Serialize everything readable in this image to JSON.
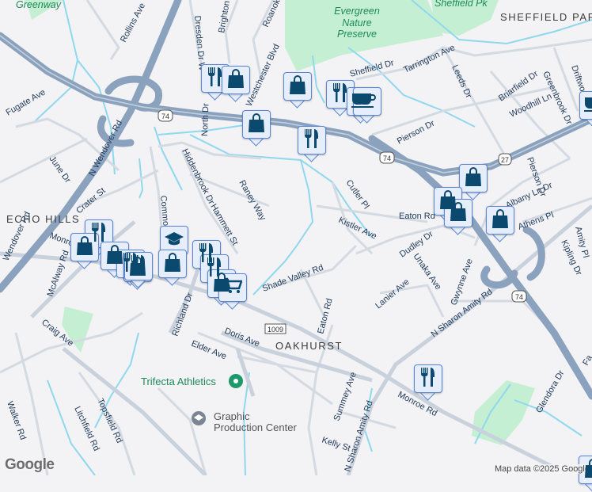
{
  "map": {
    "neighborhoods": [
      "ECHO HILLS",
      "OAKHURST",
      "SHEFFIELD PARK"
    ],
    "parks": [
      "Greenway",
      "Evergreen",
      "Nature",
      "Preserve",
      "Sheffield Pk"
    ],
    "pois": {
      "trifecta": "Trifecta Athletics",
      "graphic_1": "Graphic",
      "graphic_2": "Production Center"
    },
    "shields": {
      "us74": "74",
      "us27": "27",
      "sr1009": "1009"
    },
    "streets": {
      "rollins": "Rollins Ave",
      "dresden": "Dresden Dr W",
      "brighton": "Brighton",
      "roanoke": "Roanoke",
      "westchester": "Westchester Blvd",
      "north": "North Dr",
      "fugate": "Fugate Ave",
      "wendover_n": "N Wendover Rd",
      "wendover": "Wendover Rd",
      "june": "June Dr",
      "crater": "Crater St",
      "hiddenbrook": "Hiddenbrook Dr",
      "raney": "Raney Way",
      "hammett": "Hammett St",
      "commonwealth": "Commo",
      "monroe_w": "Monroe",
      "sheffield": "Sheffield Dr",
      "tarrington": "Tarrington Ave",
      "leeds": "Leeds Dr",
      "briarfield": "Briarfield Dr",
      "greenbrook": "Greenbrook Dr",
      "woodhill": "Woodhill Ln",
      "driftwood": "Driftwood",
      "pierson": "Pierson Dr",
      "pierson2": "Pierson Dr",
      "cutler": "Cutler Pl",
      "eaton": "Eaton Rd",
      "kistler": "Kistler Ave",
      "albany": "Albany Ln Dr",
      "athens": "Athens Pl",
      "dudley": "Dudley Dr",
      "unaka": "Unaka Ave",
      "gwynne": "Gwynne Ave",
      "kipling": "Kipling Dr",
      "amity": "Amity Pl",
      "shade": "Shade Valley Rd",
      "lanier": "Lanier Ave",
      "eaton2": "Eaton Rd",
      "sharon": "N Sharon Amity Rd",
      "sharon2": "N Sharon Amity Rd",
      "mcalway": "McAlway Rd",
      "craig": "Craig Ave",
      "richland": "Richland Dr",
      "doris": "Doris Ave",
      "elder": "Elder Ave",
      "summey": "Summey Ave",
      "monroe": "Monroe Rd",
      "kelly": "Kelly St",
      "walker": "Walker Rd",
      "topsfield": "Topsfield Rd",
      "litchfield": "Litchfield Rd",
      "glendora": "Glendora Dr",
      "fa": "Fa"
    },
    "attribution": "Map data ©2025 Google",
    "logo": "Google"
  },
  "markers": [
    {
      "type": "restaurant"
    },
    {
      "type": "shopping"
    },
    {
      "type": "shopping"
    },
    {
      "type": "restaurant"
    },
    {
      "type": "cafe"
    },
    {
      "type": "cafe"
    },
    {
      "type": "shopping"
    },
    {
      "type": "restaurant"
    },
    {
      "type": "shopping"
    },
    {
      "type": "shopping"
    },
    {
      "type": "shopping"
    },
    {
      "type": "shopping"
    },
    {
      "type": "cafe"
    },
    {
      "type": "school"
    },
    {
      "type": "restaurant"
    },
    {
      "type": "shopping"
    },
    {
      "type": "shopping"
    },
    {
      "type": "restaurant"
    },
    {
      "type": "shopping"
    },
    {
      "type": "restaurant"
    },
    {
      "type": "shopping"
    },
    {
      "type": "restaurant"
    },
    {
      "type": "restaurant"
    },
    {
      "type": "shopping"
    },
    {
      "type": "grocery"
    }
  ],
  "colors": {
    "highway": "#8aa2bd",
    "road": "#cfd7e0",
    "water": "#8fd8ee",
    "park": "#c4efd2",
    "marker_bg": "#e6eefc",
    "marker_icon": "#0b4a6e"
  }
}
